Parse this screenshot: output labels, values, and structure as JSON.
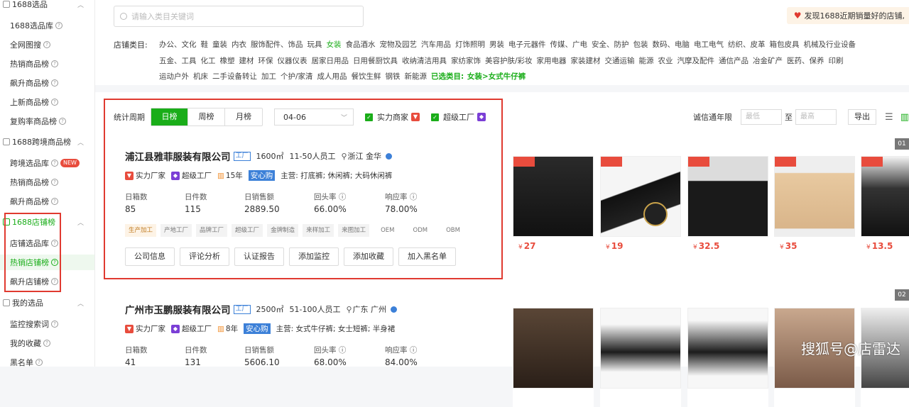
{
  "sidebar": {
    "sections": [
      {
        "label": "1688选品",
        "items": [
          {
            "label": "1688选品库"
          },
          {
            "label": "全网图搜"
          },
          {
            "label": "热销商品榜"
          },
          {
            "label": "飙升商品榜"
          },
          {
            "label": "上新商品榜"
          },
          {
            "label": "复购率商品榜"
          }
        ]
      },
      {
        "label": "1688跨境商品榜",
        "items": [
          {
            "label": "跨境选品库",
            "badge": "NEW"
          },
          {
            "label": "热销商品榜"
          },
          {
            "label": "飙升商品榜"
          }
        ]
      },
      {
        "label": "1688店铺榜",
        "items": [
          {
            "label": "店铺选品库"
          },
          {
            "label": "热销店铺榜",
            "active": true
          },
          {
            "label": "飙升店铺榜"
          }
        ]
      },
      {
        "label": "我的选品",
        "items": [
          {
            "label": "监控搜索词"
          },
          {
            "label": "我的收藏"
          },
          {
            "label": "黑名单"
          }
        ]
      }
    ]
  },
  "search": {
    "placeholder": "请输入类目关键词"
  },
  "discover_banner": "发现1688近期销量好的店铺,",
  "category": {
    "label": "店铺类目:",
    "lines": [
      [
        "办公、文化",
        "鞋",
        "童装",
        "内衣",
        "服饰配件、饰品",
        "玩具",
        "女装",
        "食品酒水",
        "宠物及园艺",
        "汽车用品",
        "灯饰照明",
        "男装",
        "电子元器件",
        "传媒、广电",
        "安全、防护",
        "包装",
        "数码、电脑",
        "电工电气",
        "纺织、皮革",
        "箱包皮具",
        "机械及行业设备"
      ],
      [
        "五金、工具",
        "化工",
        "橡塑",
        "建材",
        "环保",
        "仪器仪表",
        "居家日用品",
        "日用餐厨饮具",
        "收纳清洁用具",
        "家纺家饰",
        "美容护肤/彩妆",
        "家用电器",
        "家装建材",
        "交通运输",
        "能源",
        "农业",
        "汽摩及配件",
        "通信产品",
        "冶金矿产",
        "医药、保养",
        "印刷"
      ],
      [
        "运动户外",
        "机床",
        "二手设备转让",
        "加工",
        "个护/家清",
        "成人用品",
        "餐饮生鲜",
        "钢铁",
        "新能源"
      ]
    ],
    "highlighted": "女装",
    "selected_text": "已选类目: 女装>女式牛仔裤"
  },
  "filter": {
    "period_label": "统计周期",
    "tabs": [
      "日榜",
      "周榜",
      "月榜"
    ],
    "active_tab": "日榜",
    "date": "04-06",
    "check1": "实力商家",
    "check2": "超级工厂",
    "years_label": "诚信通年限",
    "min_placeholder": "最低",
    "to": "至",
    "max_placeholder": "最高",
    "export": "导出"
  },
  "shops": [
    {
      "name": "浦江县雅菲服装有限公司",
      "factory_tag": "工厂",
      "area": "1600㎡",
      "staff": "11-50人员工",
      "location": "浙江 金华",
      "badge1": "实力厂家",
      "badge2": "超级工厂",
      "years": "15年",
      "anxin": "安心购",
      "main": "主营: 打底裤; 休闲裤; 大码休闲裤",
      "stats": [
        {
          "label": "日箱数",
          "value": "85"
        },
        {
          "label": "日件数",
          "value": "115"
        },
        {
          "label": "日销售额",
          "value": "2889.50"
        },
        {
          "label": "回头率",
          "value": "66.00%"
        },
        {
          "label": "响应率",
          "value": "78.00%"
        }
      ],
      "tags": [
        "生产加工",
        "产地工厂",
        "品牌工厂",
        "超级工厂",
        "金牌制造",
        "来样加工",
        "来图加工",
        "OEM",
        "ODM",
        "OBM"
      ],
      "actions": [
        "公司信息",
        "评论分析",
        "认证报告",
        "添加监控",
        "添加收藏",
        "加入黑名单"
      ],
      "rank": "01",
      "prices": [
        "27",
        "19",
        "32.5",
        "35",
        "13.5"
      ]
    },
    {
      "name": "广州市玉鹏服装有限公司",
      "factory_tag": "工厂",
      "area": "2500㎡",
      "staff": "51-100人员工",
      "location": "广东 广州",
      "badge1": "实力厂家",
      "badge2": "超级工厂",
      "years": "8年",
      "anxin": "安心购",
      "main": "主营: 女式牛仔裤; 女士短裤; 半身裙",
      "stats": [
        {
          "label": "日箱数",
          "value": "41"
        },
        {
          "label": "日件数",
          "value": "131"
        },
        {
          "label": "日销售额",
          "value": "5606.10"
        },
        {
          "label": "回头率",
          "value": "68.00%"
        },
        {
          "label": "响应率",
          "value": "84.00%"
        }
      ],
      "rank": "02"
    }
  ],
  "currency": "¥",
  "watermark": "搜狐号@店雷达",
  "colors": {
    "accent": "#1aad19",
    "highlight_box": "#e03a30",
    "price": "#e84c3d"
  }
}
